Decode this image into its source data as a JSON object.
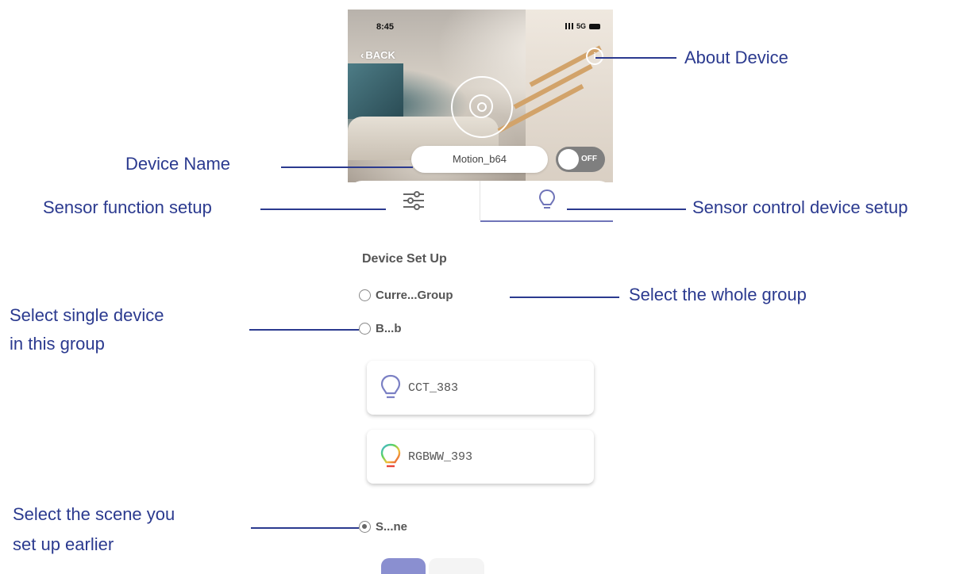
{
  "status_bar": {
    "time": "8:45",
    "network": "5G"
  },
  "header": {
    "back_label": "BACK",
    "info_icon": "info-icon",
    "device_name": "Motion_b64",
    "toggle_label": "OFF"
  },
  "tabs": [
    {
      "icon": "sliders-icon"
    },
    {
      "icon": "bulb-icon"
    }
  ],
  "content": {
    "section_title": "Device Set Up",
    "options": [
      {
        "label": "Curre...Group",
        "checked": false
      },
      {
        "label": "B...b",
        "checked": false
      },
      {
        "label": "S...ne",
        "checked": true
      }
    ],
    "devices": [
      {
        "name": "CCT_383",
        "icon": "bulb-icon"
      },
      {
        "name": "RGBWW_393",
        "icon": "rgb-bulb-icon"
      }
    ]
  },
  "annotations": {
    "about_device": "About Device",
    "device_name": "Device Name",
    "sensor_function_setup": "Sensor function setup",
    "sensor_control_device_setup": "Sensor control device setup",
    "select_whole_group": "Select the whole group",
    "select_single_line1": "Select single  device",
    "select_single_line2": "in this group",
    "select_scene_line1": "Select the scene you",
    "select_scene_line2": "set up earlier"
  },
  "colors": {
    "annotation": "#2b3a8f",
    "accent": "#6f74b8"
  }
}
